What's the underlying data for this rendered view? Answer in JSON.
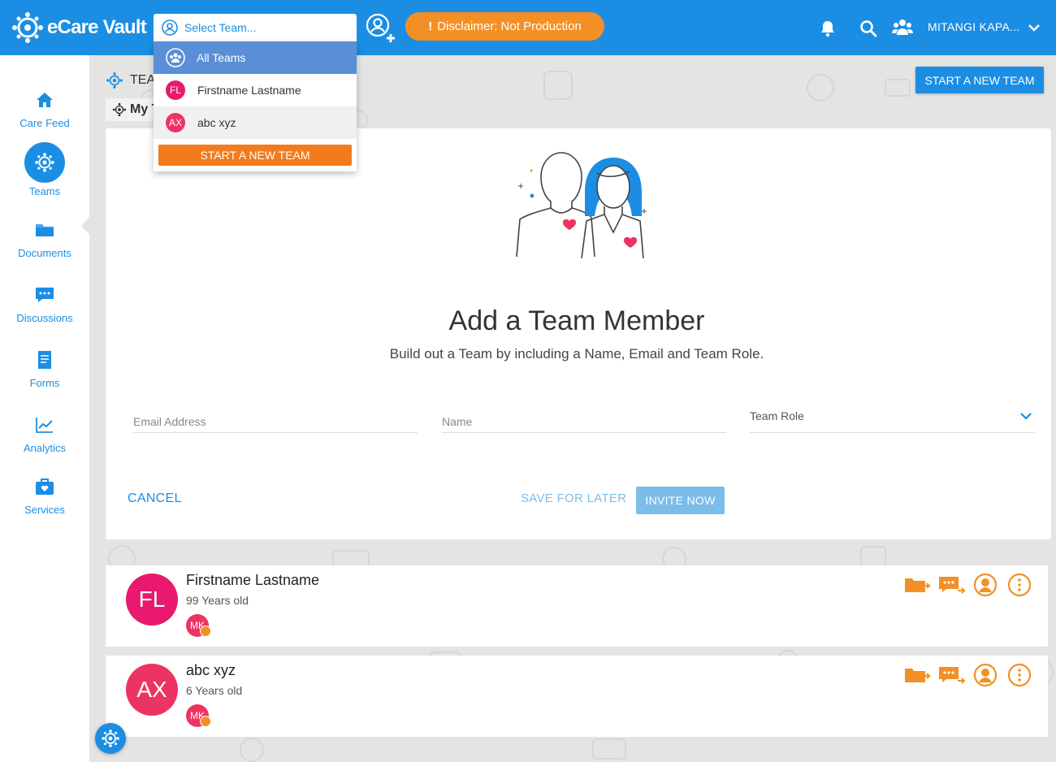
{
  "app": {
    "title": "eCare Vault"
  },
  "header": {
    "team_select_placeholder": "Select Team...",
    "disclaimer_mark": "!",
    "disclaimer": "Disclaimer: Not Production",
    "user_name": "MITANGI KAPA...",
    "icons": [
      "add-user-icon",
      "bell-icon",
      "search-icon",
      "people-icon",
      "chevron-down-icon"
    ]
  },
  "dropdown": {
    "items": [
      {
        "label": "All Teams",
        "icon": "group-icon",
        "selected": true
      },
      {
        "initials": "FL",
        "label": "Firstname Lastname"
      },
      {
        "initials": "AX",
        "label": "abc xyz"
      }
    ],
    "start_label": "START A NEW TEAM"
  },
  "sidebar": {
    "items": [
      {
        "label": "Care Feed",
        "icon": "home-icon"
      },
      {
        "label": "Teams",
        "icon": "teams-icon",
        "active": true
      },
      {
        "label": "Documents",
        "icon": "folder-icon"
      },
      {
        "label": "Discussions",
        "icon": "chat-icon"
      },
      {
        "label": "Forms",
        "icon": "form-icon"
      },
      {
        "label": "Analytics",
        "icon": "chart-icon"
      },
      {
        "label": "Services",
        "icon": "briefcase-icon"
      }
    ]
  },
  "page": {
    "breadcrumb": "TEA",
    "tab": "My T",
    "start_team_label": "START A NEW TEAM"
  },
  "card": {
    "title": "Add a Team Member",
    "subtitle": "Build out a Team by including a Name, Email and Team Role.",
    "email_placeholder": "Email Address",
    "name_placeholder": "Name",
    "role_label": "Team Role",
    "cancel_label": "CANCEL",
    "save_label": "SAVE FOR LATER",
    "invite_label": "INVITE NOW"
  },
  "members": [
    {
      "initials": "FL",
      "name": "Firstname Lastname",
      "age": "99 Years old",
      "mini": "MK",
      "color": "#e8196f"
    },
    {
      "initials": "AX",
      "name": "abc xyz",
      "age": "6 Years old",
      "mini": "MK",
      "color": "#ec3462"
    }
  ],
  "colors": {
    "primary": "#1b8ee3",
    "accent": "#f39025",
    "action_orange": "#f37b1d"
  }
}
